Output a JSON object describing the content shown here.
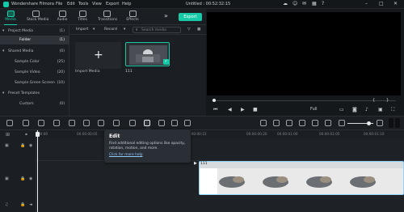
{
  "titlebar": {
    "app_name": "Wondershare Filmora",
    "menus": [
      "File",
      "Edit",
      "Tools",
      "View",
      "Export",
      "Help"
    ],
    "doc_title": "Untitled : 00:52:32:15"
  },
  "toolbar": {
    "tabs": [
      {
        "label": "Media",
        "icon": "media-icon"
      },
      {
        "label": "Stock Media",
        "icon": "stock-media-icon"
      },
      {
        "label": "Audio",
        "icon": "audio-icon"
      },
      {
        "label": "Titles",
        "icon": "titles-icon"
      },
      {
        "label": "Transitions",
        "icon": "transitions-icon"
      },
      {
        "label": "Effects",
        "icon": "effects-icon"
      }
    ],
    "more": "»",
    "export_label": "Export"
  },
  "sidebar": {
    "items": [
      {
        "label": "Project Media",
        "count": "(1)"
      },
      {
        "label": "Folder",
        "count": "(1)"
      },
      {
        "label": "Shared Media",
        "count": "(0)"
      },
      {
        "label": "Sample Color",
        "count": "(25)"
      },
      {
        "label": "Sample Video",
        "count": "(20)"
      },
      {
        "label": "Sample Green Screen",
        "count": "(10)"
      },
      {
        "label": "Preset Templates",
        "count": ""
      },
      {
        "label": "Custom",
        "count": "(0)"
      }
    ]
  },
  "mediabar": {
    "import_label": "Import",
    "record_label": "Record",
    "search_placeholder": "Search media"
  },
  "media": {
    "import_label": "Import Media",
    "clip_name": "111"
  },
  "preview": {
    "quality": "Full",
    "time_marks": [
      "{",
      "}"
    ]
  },
  "ruler": {
    "ticks": [
      "00:00",
      "00:00:00:05",
      "00:00:00:10",
      "00:00:00:15",
      "00:00:00:20",
      "00:00:01:00",
      "00:00:01:05",
      "00:00:01:10"
    ]
  },
  "timeline": {
    "clip_label": "111"
  },
  "tooltip": {
    "title": "Edit",
    "description": "Find additional editing options like opacity, rotation, motion, and more.",
    "link": "Click for more help"
  },
  "colors": {
    "accent": "#17c9a6",
    "background": "#1b1e22"
  }
}
